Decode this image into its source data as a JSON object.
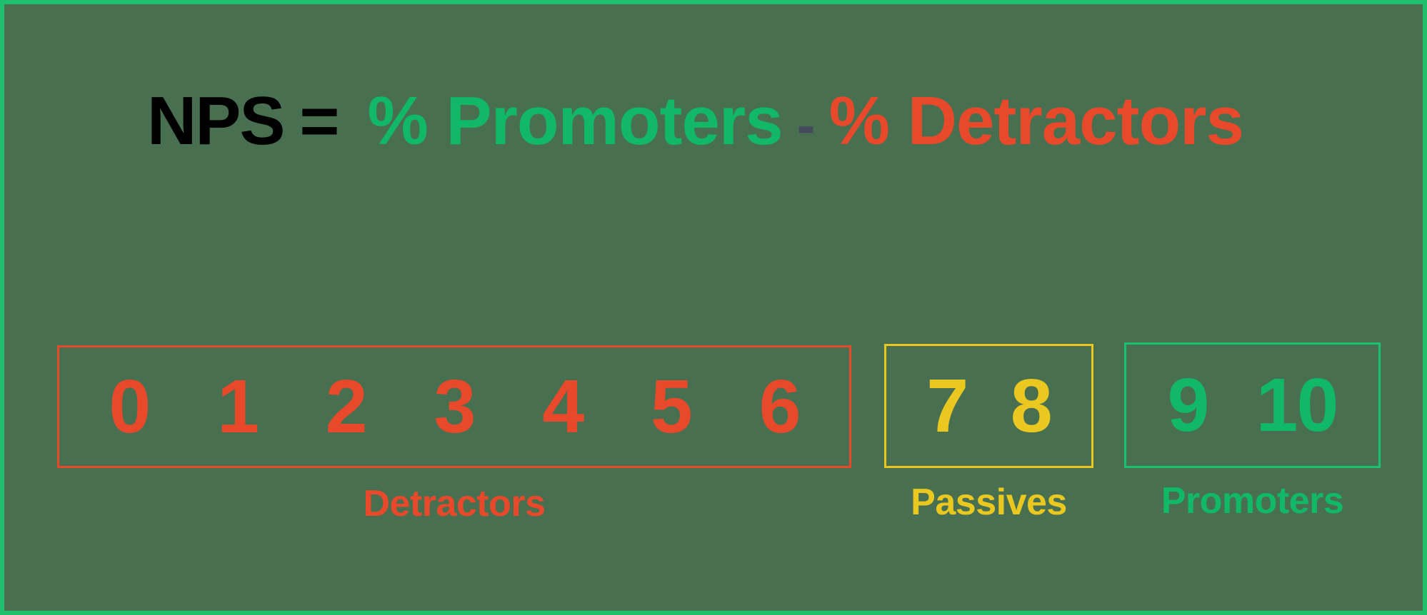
{
  "colors": {
    "background": "#487050",
    "outer_border": "#1fbf6e",
    "detractor_red": "#e8492a",
    "passive_yellow": "#eac81f",
    "promoter_green": "#10b868",
    "formula_black": "#000000",
    "minus_slate": "#454b5a"
  },
  "formula": {
    "nps": "NPS",
    "equals": "=",
    "promoters_term": "% Promoters",
    "minus": "-",
    "detractors_term": "% Detractors"
  },
  "scale": {
    "groups": [
      {
        "key": "detractors",
        "label": "Detractors",
        "digits": [
          "0",
          "1",
          "2",
          "3",
          "4",
          "5",
          "6"
        ],
        "color": "#e8492a"
      },
      {
        "key": "passives",
        "label": "Passives",
        "digits": [
          "7",
          "8"
        ],
        "color": "#eac81f"
      },
      {
        "key": "promoters",
        "label": "Promoters",
        "digits": [
          "9",
          "10"
        ],
        "color": "#10b868"
      }
    ]
  }
}
